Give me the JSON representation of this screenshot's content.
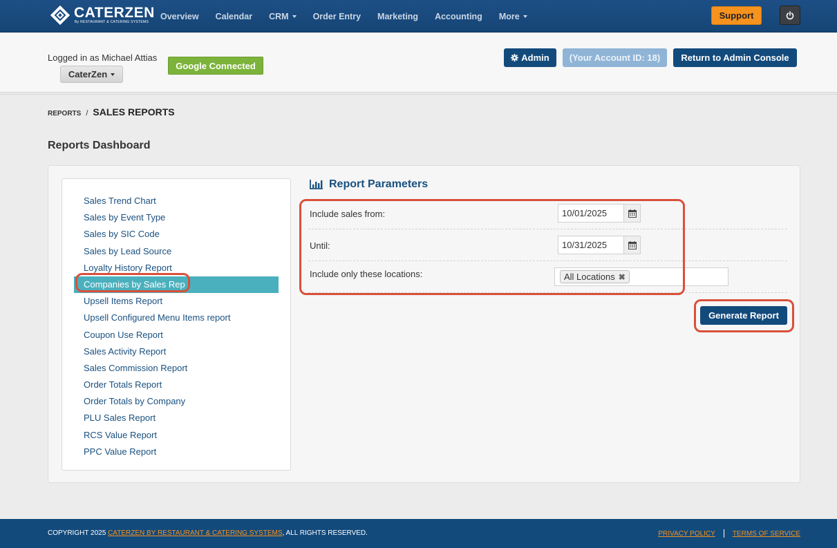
{
  "nav": {
    "logo_text": "CATERZEN",
    "logo_sub": "By RESTAURANT & CATERING SYSTEMS",
    "items": [
      {
        "label": "Overview"
      },
      {
        "label": "Calendar"
      },
      {
        "label": "CRM",
        "dropdown": true
      },
      {
        "label": "Order Entry"
      },
      {
        "label": "Marketing"
      },
      {
        "label": "Accounting"
      },
      {
        "label": "More",
        "dropdown": true
      }
    ],
    "support_label": "Support",
    "power_icon": "power-icon"
  },
  "header": {
    "logged_in": "Logged in as Michael Attias",
    "company": "CaterZen",
    "google": "Google Connected",
    "admin": "Admin",
    "account_id": "(Your Account ID: 18)",
    "return": "Return to Admin Console"
  },
  "breadcrumb": {
    "root": "REPORTS",
    "separator": "/",
    "current": "SALES REPORTS"
  },
  "page_title": "Reports Dashboard",
  "reports": [
    "Sales Trend Chart",
    "Sales by Event Type",
    "Sales by SIC Code",
    "Sales by Lead Source",
    "Loyalty History Report",
    "Companies by Sales Rep",
    "Upsell Items Report",
    "Upsell Configured Menu Items report",
    "Coupon Use Report",
    "Sales Activity Report",
    "Sales Commission Report",
    "Order Totals Report",
    "Order Totals by Company",
    "PLU Sales Report",
    "RCS Value Report",
    "PPC Value Report"
  ],
  "active_report": "Companies by Sales Rep",
  "params": {
    "title": "Report Parameters",
    "from_label": "Include sales from:",
    "from_value": "10/01/2025",
    "until_label": "Until:",
    "until_value": "10/31/2025",
    "locations_label": "Include only these locations:",
    "location_tag": "All Locations",
    "remove_glyph": "✖",
    "generate": "Generate Report"
  },
  "footer": {
    "copyright_prefix": "COPYRIGHT 2025",
    "company_link": "CATERZEN BY RESTAURANT & CATERING SYSTEMS",
    "copyright_suffix": ", ALL RIGHTS RESERVED.",
    "privacy": "PRIVACY POLICY",
    "terms": "TERMS OF SERVICE"
  },
  "colors": {
    "nav_bg": "#1d4f86",
    "accent_orange": "#f6921e",
    "primary_button": "#134a7c",
    "active_item": "#4ab0bd",
    "highlight": "#d9503a",
    "google_green": "#7cb33a"
  }
}
